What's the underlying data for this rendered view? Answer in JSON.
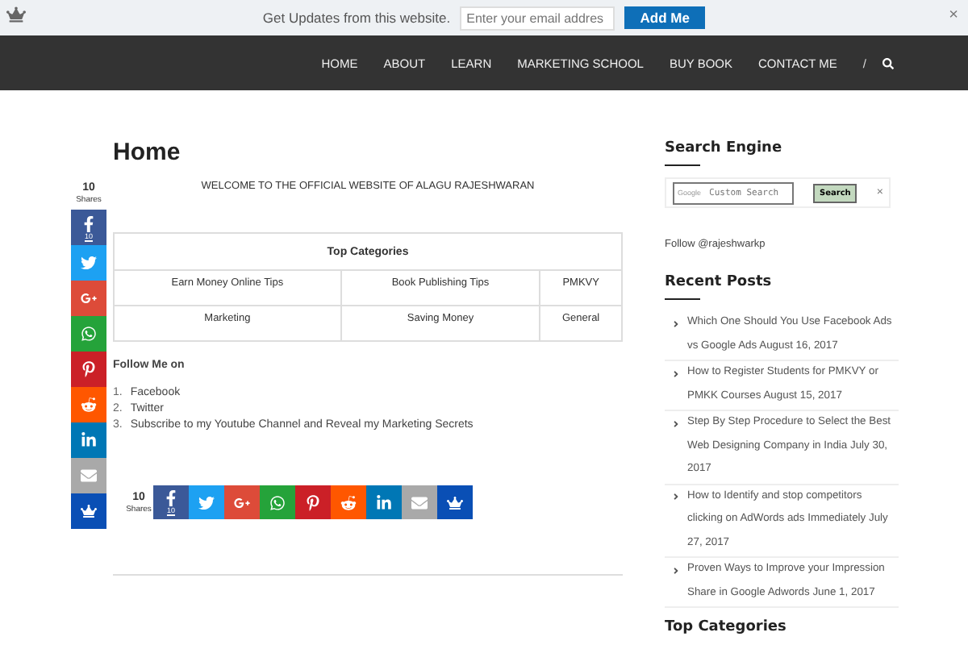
{
  "topbar": {
    "message": "Get Updates from this website.",
    "email_placeholder": "Enter your email addres",
    "button": "Add Me",
    "close": "×"
  },
  "nav": {
    "items": [
      "HOME",
      "ABOUT",
      "LEARN",
      "MARKETING SCHOOL",
      "BUY BOOK",
      "CONTACT ME"
    ],
    "separator": "/"
  },
  "page": {
    "title": "Home",
    "welcome": "WELCOME TO THE OFFICIAL WEBSITE OF ALAGU RAJESHWARAN",
    "categories_table": {
      "heading": "Top Categories",
      "rows": [
        [
          "Earn Money Online Tips",
          "Book Publishing Tips",
          "PMKVY"
        ],
        [
          "Marketing",
          "Saving Money",
          "General"
        ]
      ]
    },
    "follow_heading": "Follow Me on",
    "follow_list": [
      {
        "number": "1.",
        "text": "Facebook"
      },
      {
        "number": "2.",
        "text": "Twitter"
      },
      {
        "number": "3.",
        "text": "Subscribe to my Youtube Channel and Reveal my Marketing Secrets"
      }
    ]
  },
  "share_side": {
    "count": "10",
    "label": "Shares",
    "buttons": [
      {
        "kind": "facebook",
        "count": "10"
      },
      {
        "kind": "twitter"
      },
      {
        "kind": "googleplus"
      },
      {
        "kind": "whatsapp"
      },
      {
        "kind": "pinterest"
      },
      {
        "kind": "reddit"
      },
      {
        "kind": "linkedin"
      },
      {
        "kind": "email"
      },
      {
        "kind": "crown"
      }
    ]
  },
  "share_inline": {
    "count": "10",
    "label": "Shares",
    "buttons": [
      {
        "kind": "facebook",
        "count": "10"
      },
      {
        "kind": "twitter"
      },
      {
        "kind": "googleplus"
      },
      {
        "kind": "whatsapp"
      },
      {
        "kind": "pinterest"
      },
      {
        "kind": "reddit"
      },
      {
        "kind": "linkedin"
      },
      {
        "kind": "email"
      },
      {
        "kind": "crown"
      }
    ]
  },
  "sidebar": {
    "search_heading": "Search Engine",
    "search_brand": "Google",
    "search_placeholder": "Custom Search",
    "search_button": "Search",
    "clear": "×",
    "follow": "Follow @rajeshwarkp",
    "recent_heading": "Recent Posts",
    "posts": [
      "Which One Should You Use Facebook Ads vs Google Ads August 16, 2017",
      "How to Register Students for PMKVY or PMKK Courses August 15, 2017",
      "Step By Step Procedure to Select the Best Web Designing Company in India July 30, 2017",
      "How to Identify and stop competitors clicking on AdWords ads Immediately July 27, 2017",
      "Proven Ways to Improve your Impression Share in Google Adwords June 1, 2017"
    ],
    "categories_heading": "Top Categories"
  }
}
